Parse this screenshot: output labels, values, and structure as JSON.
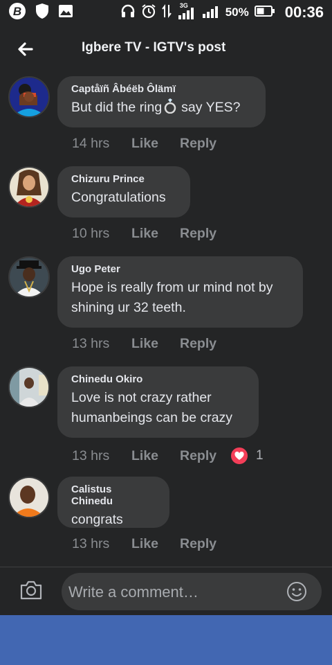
{
  "status_bar": {
    "network": "3G",
    "battery": "50%",
    "time": "00:36"
  },
  "header": {
    "title": "Igbere TV - IGTV's post"
  },
  "comments": [
    {
      "author": "Captåïñ Âbéëb Ôlämï",
      "text_before": "But did the ring",
      "text_after": "say YES?",
      "time": "14 hrs",
      "like": "Like",
      "reply": "Reply"
    },
    {
      "author": "Chizuru Prince",
      "text": "Congratulations",
      "time": "10 hrs",
      "like": "Like",
      "reply": "Reply"
    },
    {
      "author": "Ugo Peter",
      "text_line1": "Hope is really from ur mind not by",
      "text_line2": "shining ur 32 teeth.",
      "time": "13 hrs",
      "like": "Like",
      "reply": "Reply"
    },
    {
      "author": "Chinedu Okiro",
      "text_line1": "Love is not crazy rather",
      "text_line2": "humanbeings can be crazy",
      "time": "13 hrs",
      "like": "Like",
      "reply": "Reply",
      "reaction_count": "1"
    },
    {
      "author": "Calistus Chinedu",
      "text": "congrats",
      "time": "13 hrs",
      "like": "Like",
      "reply": "Reply"
    }
  ],
  "composer": {
    "placeholder": "Write a comment…"
  },
  "colors": {
    "background": "#242526",
    "bubble": "#3a3b3c",
    "reaction_heart": "#f33e58",
    "nav_strip": "#4267b2"
  }
}
